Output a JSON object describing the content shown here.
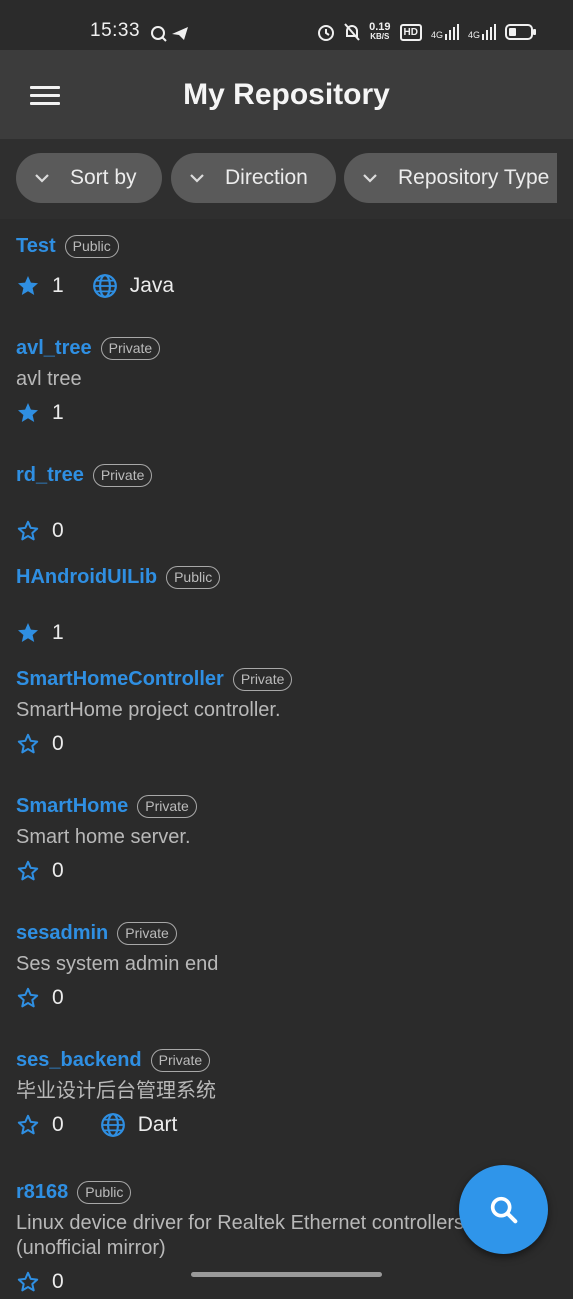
{
  "status_bar": {
    "time": "15:33",
    "net_speed_value": "0.19",
    "net_speed_unit": "KB/S",
    "hd_label": "HD",
    "signal_1": "4G",
    "signal_2": "4G"
  },
  "app_bar": {
    "title": "My Repository"
  },
  "filters": [
    {
      "label": "Sort by"
    },
    {
      "label": "Direction"
    },
    {
      "label": "Repository Type"
    }
  ],
  "repos": [
    {
      "name": "Test",
      "visibility": "Public",
      "description": "",
      "stars": "1",
      "starred": true,
      "language": "Java"
    },
    {
      "name": "avl_tree",
      "visibility": "Private",
      "description": "avl tree",
      "stars": "1",
      "starred": true,
      "language": ""
    },
    {
      "name": "rd_tree",
      "visibility": "Private",
      "description": "",
      "stars": "0",
      "starred": false,
      "language": ""
    },
    {
      "name": "HAndroidUILib",
      "visibility": "Public",
      "description": "",
      "stars": "1",
      "starred": true,
      "language": ""
    },
    {
      "name": "SmartHomeController",
      "visibility": "Private",
      "description": "SmartHome project controller.",
      "stars": "0",
      "starred": false,
      "language": ""
    },
    {
      "name": "SmartHome",
      "visibility": "Private",
      "description": "Smart home server.",
      "stars": "0",
      "starred": false,
      "language": ""
    },
    {
      "name": "sesadmin",
      "visibility": "Private",
      "description": "Ses system admin end",
      "stars": "0",
      "starred": false,
      "language": ""
    },
    {
      "name": "ses_backend",
      "visibility": "Private",
      "description": "毕业设计后台管理系统",
      "stars": "0",
      "starred": false,
      "language": "Dart"
    },
    {
      "name": "r8168",
      "visibility": "Public",
      "description": "Linux device driver for Realtek Ethernet controllers (unofficial mirror)",
      "stars": "0",
      "starred": false,
      "language": ""
    }
  ],
  "fab": {
    "icon": "search-icon"
  },
  "colors": {
    "accent": "#2f8fe2",
    "fab": "#2f95ea",
    "background": "#2b2b2b",
    "app_bar": "#3c3c3c",
    "chip": "#5a5a5a"
  }
}
